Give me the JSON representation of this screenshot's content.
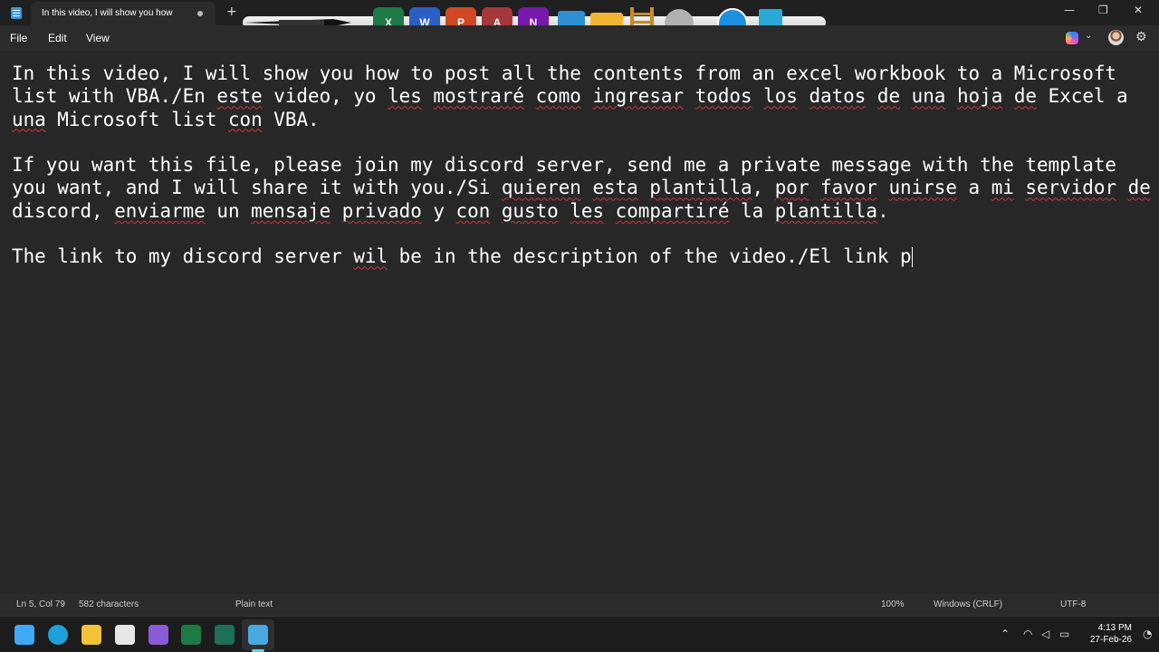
{
  "window": {
    "tab_title": "In this video, I will show you how",
    "new_tab_label": "+",
    "minimize_label": "—",
    "maximize_label": "❐",
    "close_label": "✕"
  },
  "dock": {
    "items": [
      {
        "name": "excel",
        "glyph": "X",
        "color": "#1d7a45"
      },
      {
        "name": "word",
        "glyph": "W",
        "color": "#2b5fc4"
      },
      {
        "name": "powerpoint",
        "glyph": "P",
        "color": "#d24726"
      },
      {
        "name": "access",
        "glyph": "A",
        "color": "#a4373a"
      },
      {
        "name": "onenote",
        "glyph": "N",
        "color": "#7719aa"
      }
    ]
  },
  "menu": {
    "file": "File",
    "edit": "Edit",
    "view": "View"
  },
  "document": {
    "lines": [
      "In this video, I will show you how to post all the contents from an excel workbook to a Microsoft",
      "list with VBA./En este video, yo les mostraré como ingresar todos los datos de una hoja de Excel a",
      "una Microsoft list con VBA.",
      "",
      "If you want this file, please join my discord server, send me a private message with the template",
      "you want, and I will share it with you./Si quieren esta plantilla, por favor unirse a mi servidor de",
      "discord, enviarme un mensaje privado y con gusto les compartiré la plantilla.",
      "",
      "The link to my discord server wil be in the description of the video./El link p"
    ]
  },
  "status": {
    "position": "Ln 5, Col 79",
    "characters": "582 characters",
    "format": "Plain text",
    "zoom": "100%",
    "line_endings": "Windows (CRLF)",
    "encoding": "UTF-8"
  },
  "taskbar": {
    "time": "4:13 PM",
    "date": "27-Feb-26",
    "apps": [
      {
        "name": "start",
        "color": "#3fa9f5"
      },
      {
        "name": "edge",
        "color": "#1fa0d8"
      },
      {
        "name": "file-explorer",
        "color": "#f3c13a"
      },
      {
        "name": "store",
        "color": "#e8e8e8"
      },
      {
        "name": "visual-studio",
        "color": "#8a5bd6"
      },
      {
        "name": "excel",
        "color": "#1d7a45"
      },
      {
        "name": "terminal",
        "color": "#1e6e5a"
      },
      {
        "name": "notepad",
        "color": "#4aa8e0"
      }
    ]
  }
}
